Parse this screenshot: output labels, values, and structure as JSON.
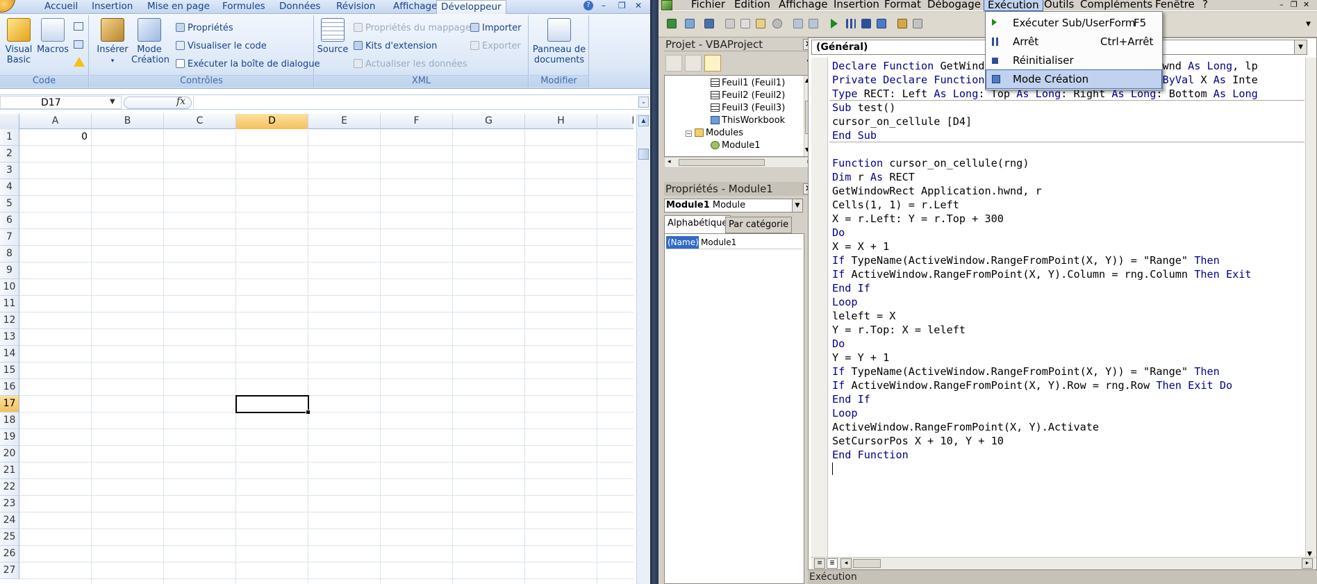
{
  "excel": {
    "tabs": [
      "Accueil",
      "Insertion",
      "Mise en page",
      "Formules",
      "Données",
      "Révision",
      "Affichage",
      "Développeur"
    ],
    "active_tab": "Développeur",
    "ribbon": {
      "code": {
        "label": "Code",
        "visual_basic": "Visual Basic",
        "macros": "Macros"
      },
      "controles": {
        "label": "Contrôles",
        "inserer": "Insérer",
        "mode_creation": "Mode Création",
        "proprietes": "Propriétés",
        "visualiser_code": "Visualiser le code",
        "executer_boite": "Exécuter la boîte de dialogue"
      },
      "xml": {
        "label": "XML",
        "source": "Source",
        "prop_mappage": "Propriétés du mappage",
        "kits": "Kits d'extension",
        "actualiser": "Actualiser les données",
        "importer": "Importer",
        "exporter": "Exporter"
      },
      "modifier": {
        "label": "Modifier",
        "panneau": "Panneau de documents"
      }
    },
    "name_box": "D17",
    "fx_symbol": "fx",
    "columns": [
      "A",
      "B",
      "C",
      "D",
      "E",
      "F",
      "G",
      "H",
      "I"
    ],
    "selected_column": "D",
    "rows": [
      "1",
      "2",
      "3",
      "4",
      "5",
      "6",
      "7",
      "8",
      "9",
      "10",
      "11",
      "12",
      "13",
      "14",
      "15",
      "16",
      "17",
      "18",
      "19",
      "20",
      "21",
      "22",
      "23",
      "24",
      "25",
      "26",
      "27"
    ],
    "selected_row": "17",
    "cells": {
      "A1": "0"
    }
  },
  "vbe": {
    "menus": [
      "Fichier",
      "Edition",
      "Affichage",
      "Insertion",
      "Format",
      "Débogage",
      "Exécution",
      "Outils",
      "Compléments",
      "Fenêtre",
      "?"
    ],
    "open_menu": "Exécution",
    "project": {
      "title": "Projet - VBAProject",
      "close": "×",
      "nodes": [
        {
          "label": "Feuil1 (Feuil1)",
          "kind": "sheet"
        },
        {
          "label": "Feuil2 (Feuil2)",
          "kind": "sheet"
        },
        {
          "label": "Feuil3 (Feuil3)",
          "kind": "sheet"
        },
        {
          "label": "ThisWorkbook",
          "kind": "workbook"
        },
        {
          "label": "Modules",
          "kind": "folder"
        },
        {
          "label": "Module1",
          "kind": "module"
        }
      ]
    },
    "properties": {
      "title": "Propriétés - Module1",
      "combo_name": "Module1",
      "combo_type": "Module",
      "tab_alpha": "Alphabétique",
      "tab_cat": "Par catégorie",
      "prop_name": "(Name)",
      "prop_value": "Module1"
    },
    "code": {
      "object": "(Général)",
      "lines": [
        "Declare Function GetWindowRect Lib \"user32\" (ByVal hwnd As Long, lp",
        "Private Declare Function SetCursorPos Lib \"user32\" (ByVal X As Inte",
        "Type RECT: Left As Long: Top As Long: Right As Long: Bottom As Long",
        "Sub test()",
        "cursor_on_cellule [D4]",
        "End Sub",
        "",
        "Function cursor_on_cellule(rng)",
        "Dim r As RECT",
        "GetWindowRect Application.hwnd, r",
        "Cells(1, 1) = r.Left",
        "X = r.Left: Y = r.Top + 300",
        "Do",
        "X = X + 1",
        "If TypeName(ActiveWindow.RangeFromPoint(X, Y)) = \"Range\" Then",
        "If ActiveWindow.RangeFromPoint(X, Y).Column = rng.Column Then Exit",
        "End If",
        "Loop",
        "leleft = X",
        "Y = r.Top: X = leleft",
        "Do",
        "Y = Y + 1",
        "If TypeName(ActiveWindow.RangeFromPoint(X, Y)) = \"Range\" Then",
        "If ActiveWindow.RangeFromPoint(X, Y).Row = rng.Row Then Exit Do",
        "End If",
        "Loop",
        "ActiveWindow.RangeFromPoint(X, Y).Activate",
        "SetCursorPos X + 10, Y + 10",
        "End Function"
      ]
    },
    "exec_panel": "Exécution",
    "exec_menu": [
      {
        "label": "Exécuter Sub/UserForm",
        "shortcut": "F5",
        "icon": "play-icon"
      },
      {
        "label": "Arrêt",
        "shortcut": "Ctrl+Arrêt",
        "icon": "pause-icon"
      },
      {
        "label": "Réinitialiser",
        "shortcut": "",
        "icon": "stop-icon"
      },
      {
        "label": "Mode Création",
        "shortcut": "",
        "icon": "design-mode-icon"
      }
    ]
  },
  "colors": {
    "vba_keyword": "#00008b",
    "excel_accent": "#15428b",
    "selection_header": "#f4c05a",
    "menu_highlight": "#c1d2ee"
  }
}
